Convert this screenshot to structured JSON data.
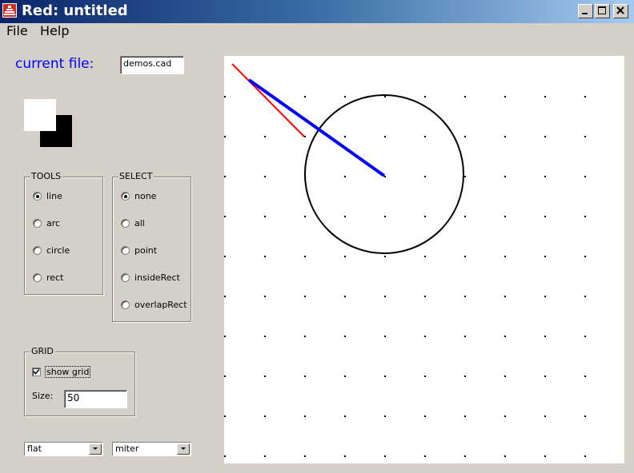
{
  "window": {
    "title": "Red: untitled",
    "icon": "red-app-icon",
    "controls": [
      "minimize-icon",
      "maximize-icon",
      "close-icon"
    ]
  },
  "menu": {
    "file_label": "File",
    "help_label": "Help"
  },
  "file": {
    "label": "current file:",
    "value": "demos.cad"
  },
  "colors": {
    "label_blue": "#0000ff",
    "foreground_swatch": "#ffffff",
    "background_swatch": "#000000",
    "selected_line": "#0000ff",
    "red_line": "#ff0000"
  },
  "tools": {
    "title": "TOOLS",
    "options": [
      "line",
      "arc",
      "circle",
      "rect"
    ],
    "selected": "line"
  },
  "select": {
    "title": "SELECT",
    "options": [
      "none",
      "all",
      "point",
      "insideRect",
      "overlapRect"
    ],
    "selected": "none"
  },
  "grid": {
    "title": "GRID",
    "show_grid_label": "show grid",
    "show_grid_checked": true,
    "size_label": "Size:",
    "size_value": "50"
  },
  "line_style": {
    "cap_value": "flat",
    "join_value": "miter"
  }
}
